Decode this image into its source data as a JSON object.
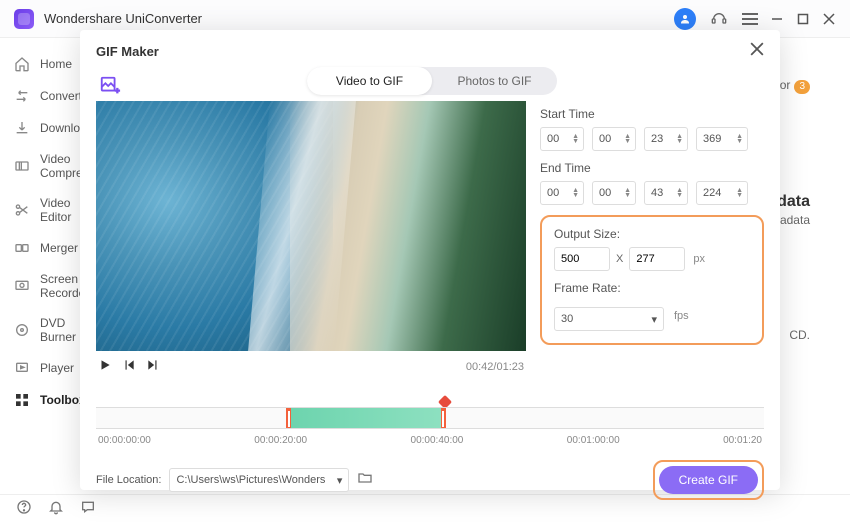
{
  "app": {
    "title": "Wondershare UniConverter"
  },
  "sidebar": {
    "items": [
      {
        "label": "Home"
      },
      {
        "label": "Converter"
      },
      {
        "label": "Downloader"
      },
      {
        "label": "Video Compressor"
      },
      {
        "label": "Video Editor"
      },
      {
        "label": "Merger"
      },
      {
        "label": "Screen Recorder"
      },
      {
        "label": "DVD Burner"
      },
      {
        "label": "Player"
      },
      {
        "label": "Toolbox"
      }
    ]
  },
  "right_bg": {
    "line1a": "tor",
    "line1badge": "3",
    "head2": "data",
    "sub2": "etadata",
    "sub3": "CD."
  },
  "modal": {
    "title": "GIF Maker",
    "tabs": {
      "video": "Video to GIF",
      "photos": "Photos to GIF"
    },
    "time": {
      "start_label": "Start Time",
      "end_label": "End Time",
      "start": {
        "h": "00",
        "m": "00",
        "s": "23",
        "ms": "369"
      },
      "end": {
        "h": "00",
        "m": "00",
        "s": "43",
        "ms": "224"
      }
    },
    "output": {
      "size_label": "Output Size:",
      "width": "500",
      "x": "X",
      "height": "277",
      "px": "px",
      "rate_label": "Frame Rate:",
      "rate_value": "30",
      "fps": "fps"
    },
    "playback": {
      "timecode": "00:42/01:23"
    },
    "timeline": {
      "ticks": [
        "00:00:00:00",
        "00:00:20:00",
        "00:00:40:00",
        "00:01:00:00",
        "00:01:20"
      ]
    },
    "file": {
      "label": "File Location:",
      "path": "C:\\Users\\ws\\Pictures\\Wonders"
    },
    "create_label": "Create GIF"
  }
}
